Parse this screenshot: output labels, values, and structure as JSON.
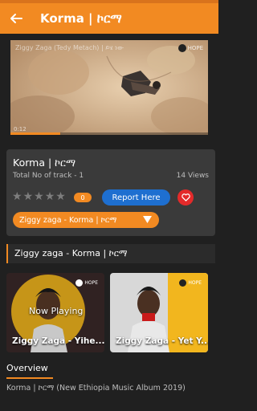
{
  "appbar": {
    "title": "Korma | ኮርማ"
  },
  "video": {
    "caption": "Ziggy Zaga (Tedy Metach) | ይሄ ነው",
    "logo_text": "HOPE",
    "time": "0:12",
    "progress": 0.25
  },
  "track": {
    "title": "Korma | ኮርማ",
    "total_tracks": "Total No of track - 1",
    "views": "14 Views",
    "rating_stars": 0,
    "rating_count": "0",
    "report_label": "Report Here",
    "selected_track": "Ziggy zaga - Korma | ኮርማ"
  },
  "section": {
    "title": "Ziggy zaga - Korma | ኮርማ"
  },
  "related": [
    {
      "title": "Ziggy Zaga - Yihe...",
      "badge": "Now Playing",
      "logo_text": "HOPE"
    },
    {
      "title": "Ziggy Zaga - Yet Y...",
      "logo_text": "HOPE"
    }
  ],
  "overview": {
    "heading": "Overview",
    "text": "Korma | ኮርማ (New Ethiopia Music Album 2019)"
  },
  "colors": {
    "accent": "#f28a22",
    "report": "#1e6fd0",
    "favorite": "#e32a2a",
    "background": "#202020",
    "card": "#3a3a3a"
  }
}
